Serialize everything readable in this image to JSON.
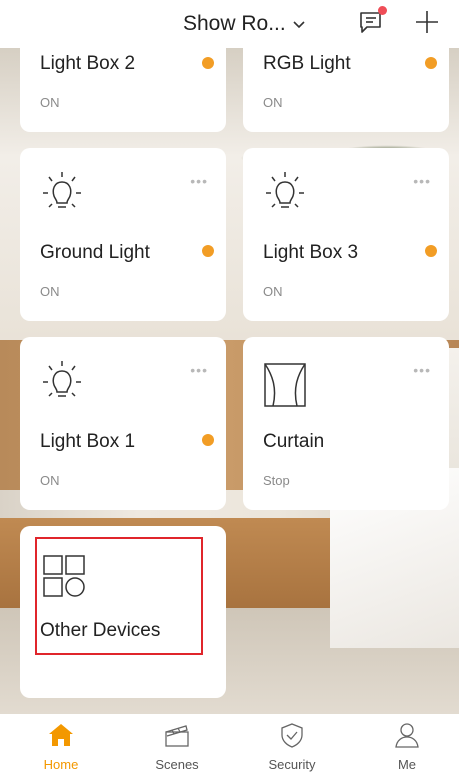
{
  "header": {
    "home_name": "Show Ro...",
    "icons": {
      "dropdown": "chevron-down-icon",
      "messages": "message-icon",
      "add": "plus-icon"
    },
    "notification_dot_color": "#ef4d57"
  },
  "devices": [
    {
      "name": "Light Box 2",
      "state": "ON",
      "icon": "bulb-icon",
      "online": true
    },
    {
      "name": "RGB Light",
      "state": "ON",
      "icon": "bulb-icon",
      "online": true
    },
    {
      "name": "Ground Light",
      "state": "ON",
      "icon": "bulb-icon",
      "online": true,
      "more": "•••"
    },
    {
      "name": "Light Box 3",
      "state": "ON",
      "icon": "bulb-icon",
      "online": true,
      "more": "•••"
    },
    {
      "name": "Light Box 1",
      "state": "ON",
      "icon": "bulb-icon",
      "online": true,
      "more": "•••"
    },
    {
      "name": "Curtain",
      "state": "Stop",
      "icon": "curtain-icon",
      "more": "•••"
    },
    {
      "name": "Other Devices",
      "icon": "grid-devices-icon"
    }
  ],
  "status_dot_color": "#f29d25",
  "tabs": [
    {
      "label": "Home",
      "icon": "home-icon",
      "active": true
    },
    {
      "label": "Scenes",
      "icon": "clapperboard-icon",
      "active": false
    },
    {
      "label": "Security",
      "icon": "shield-check-icon",
      "active": false
    },
    {
      "label": "Me",
      "icon": "person-icon",
      "active": false
    }
  ],
  "accent_color": "#f39800",
  "highlight_color": "#e0252b"
}
